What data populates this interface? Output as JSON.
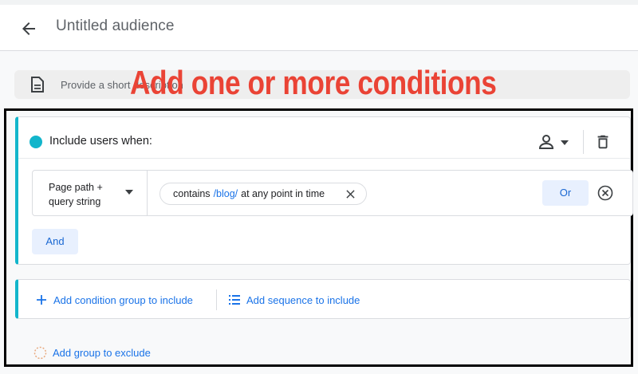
{
  "header": {
    "title": "Untitled audience",
    "back_icon": "arrow-back-icon"
  },
  "description": {
    "placeholder": "Provide a short description",
    "icon": "document-icon"
  },
  "caption": "Add one or more conditions",
  "include_group": {
    "label": "Include users when:",
    "scope_icon": "person-icon",
    "delete_icon": "trash-icon",
    "condition": {
      "dimension_line1": "Page path +",
      "dimension_line2": "query string",
      "operator": "contains",
      "value": "/blog/",
      "suffix": "at any point in time"
    },
    "or_label": "Or",
    "and_label": "And"
  },
  "add_actions": {
    "condition_group_label": "Add condition group to include",
    "sequence_label": "Add sequence to include"
  },
  "exclude": {
    "label": "Add group to exclude"
  },
  "colors": {
    "accent": "#12b5cb",
    "link": "#1a73e8",
    "caption": "#ea4335",
    "button_bg": "#e8f0fe"
  }
}
